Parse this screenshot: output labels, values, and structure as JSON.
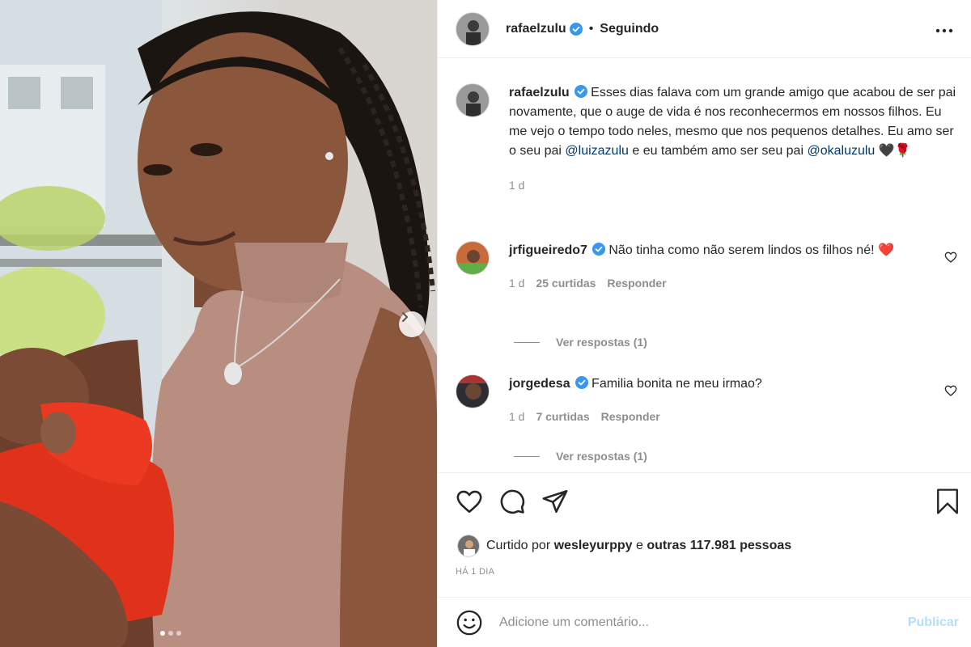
{
  "header": {
    "username": "rafaelzulu",
    "separator": "•",
    "follow_status": "Seguindo",
    "more_icon": "more-horizontal-icon"
  },
  "caption": {
    "username": "rafaelzulu",
    "text_before": "Esses dias falava com um grande amigo que acabou de ser pai novamente, que o auge de vida é nos reconhecermos em nossos filhos. Eu me vejo o tempo todo neles, mesmo que nos pequenos detalhes. Eu amo ser o seu pai",
    "mention_1": "@luizazulu",
    "text_middle": "e eu também amo ser seu pai",
    "mention_2": "@okaluzulu",
    "emojis": "🖤🌹",
    "time": "1 d"
  },
  "comments": [
    {
      "username": "jrfigueiredo7",
      "text": "Não tinha como não serem lindos os filhos né!",
      "emoji": "❤️",
      "time": "1 d",
      "likes": "25 curtidas",
      "reply_label": "Responder",
      "view_replies": "Ver respostas (1)"
    },
    {
      "username": "jorgedesa",
      "text": "Familia bonita ne meu irmao?",
      "time": "1 d",
      "likes": "7 curtidas",
      "reply_label": "Responder",
      "view_replies": "Ver respostas (1)"
    }
  ],
  "likes_summary": {
    "prefix": "Curtido por",
    "user": "wesleyurppy",
    "connector": "e",
    "others": "outras 117.981 pessoas"
  },
  "timestamp": "HÁ 1 DIA",
  "add_comment": {
    "placeholder": "Adicione um comentário...",
    "post_label": "Publicar"
  },
  "carousel": {
    "current": 1,
    "total": 3
  },
  "colors": {
    "verified": "#3897f0",
    "mention": "#00376b",
    "post_disabled": "#b2dffc",
    "heart_red": "#ed4956"
  }
}
